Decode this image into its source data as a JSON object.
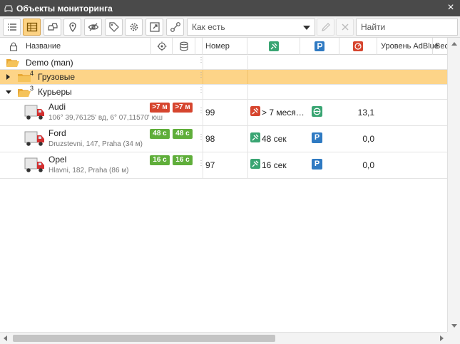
{
  "window": {
    "title": "Объекты мониторинга",
    "close": "×"
  },
  "toolbar": {
    "filter_select": "Как есть",
    "search_placeholder": "Найти"
  },
  "columns": {
    "name": "Название",
    "number": "Номер",
    "adblue": "Уровень AdBlue",
    "weight": "Вес"
  },
  "groups": [
    {
      "label": "Demo (man)",
      "count": ""
    },
    {
      "label": "Грузовые",
      "count": "4"
    },
    {
      "label": "Курьеры",
      "count": "3"
    }
  ],
  "units": [
    {
      "name": "Audi",
      "address": "106° 39,76125' вд, 6° 07,11570' юш",
      "badge1": ">7 м",
      "badge2": ">7 м",
      "badge_color": "#d6452e",
      "number": "99",
      "connection": "> 7 меся…",
      "connection_color": "#d6452e",
      "state": "moving",
      "adblue": "13,1"
    },
    {
      "name": "Ford",
      "address": "Druzstevni, 147, Praha (34 м)",
      "badge1": "48 с",
      "badge2": "48 с",
      "badge_color": "#5fae3a",
      "number": "98",
      "connection": "48 сек",
      "connection_color": "#5fae3a",
      "state": "P",
      "adblue": "0,0"
    },
    {
      "name": "Opel",
      "address": "Hlavni, 182, Praha (86 м)",
      "badge1": "16 с",
      "badge2": "16 с",
      "badge_color": "#5fae3a",
      "number": "97",
      "connection": "16 сек",
      "connection_color": "#5fae3a",
      "state": "P",
      "adblue": "0,0"
    }
  ],
  "colors": {
    "selected_row": "#fdd488",
    "titlebar": "#4a4a4a",
    "parking": "#2f7ac2",
    "moving": "#3aa573"
  }
}
